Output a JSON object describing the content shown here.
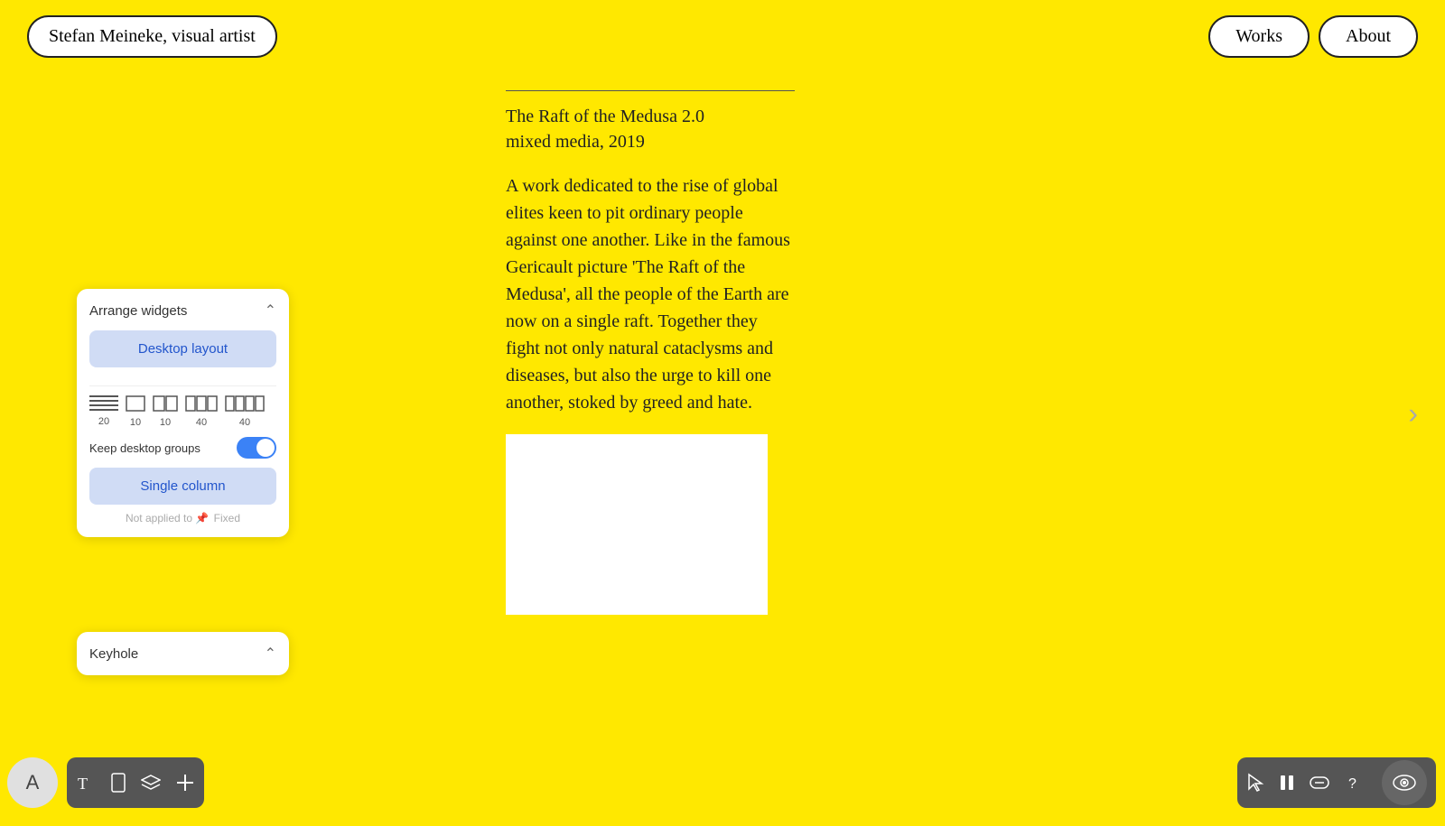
{
  "header": {
    "site_title": "Stefan Meineke, visual artist",
    "nav": {
      "works_label": "Works",
      "about_label": "About"
    }
  },
  "artwork": {
    "title": "The Raft of the Medusa 2.0",
    "medium": "mixed media, 2019",
    "description": "A work dedicated to the rise of global elites keen to pit ordinary people against one another. Like in the famous Gericault picture 'The Raft of the Medusa', all the people of the Earth are now on a single raft. Together they fight not only natural cataclysms and diseases, but also the urge to kill one another, stoked by greed and hate."
  },
  "widget_panel": {
    "title": "Arrange widgets",
    "desktop_layout_label": "Desktop layout",
    "keep_groups_label": "Keep desktop groups",
    "single_column_label": "Single column",
    "not_applied_label": "Not applied to",
    "fixed_label": "Fixed",
    "layout_values": [
      "20",
      "10",
      "10",
      "40",
      "40"
    ]
  },
  "keyhole_panel": {
    "title": "Keyhole"
  },
  "bottom_toolbar_left": {
    "avatar_label": "A",
    "tools": [
      "text-tool",
      "phone-tool",
      "layers-tool",
      "add-tool"
    ]
  },
  "bottom_toolbar_right": {
    "tools": [
      "cursor-tool",
      "pause-tool",
      "stretch-tool",
      "help-tool"
    ],
    "eye_tool": "eye-tool"
  },
  "next_arrow": "›"
}
